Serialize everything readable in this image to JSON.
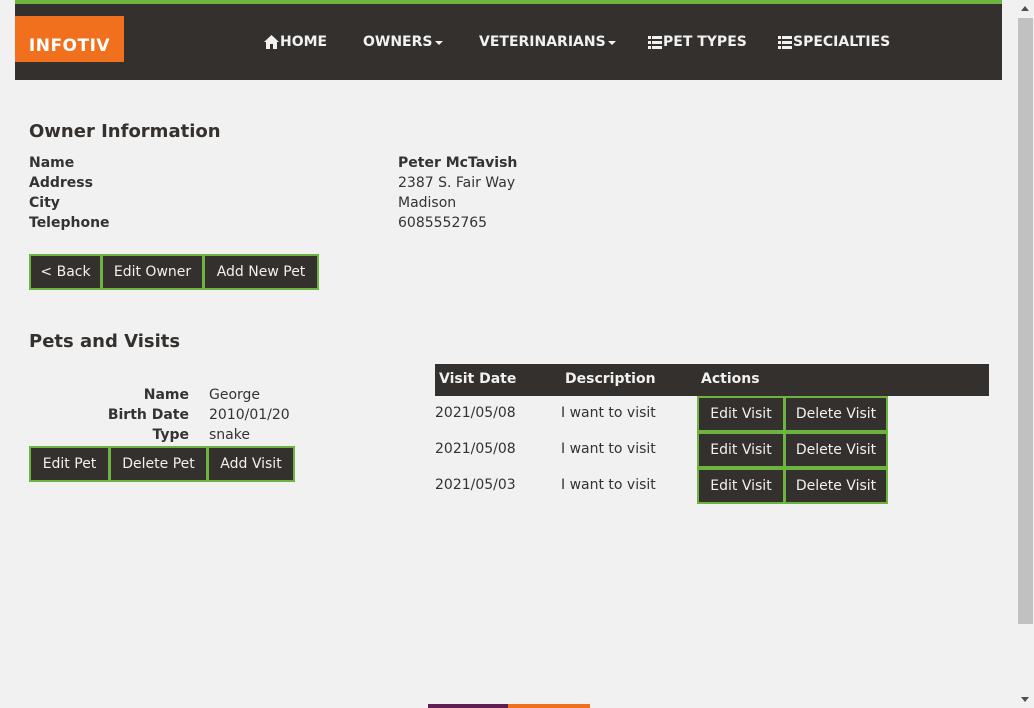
{
  "nav": {
    "brand": "INFOTIV",
    "home": "HOME",
    "owners": "OWNERS",
    "veterinarians": "VETERINARIANS",
    "pet_types": "PET TYPES",
    "specialties": "SPECIALTIES"
  },
  "owner": {
    "heading": "Owner Information",
    "fields": [
      {
        "label": "Name",
        "value": "Peter McTavish"
      },
      {
        "label": "Address",
        "value": "2387 S. Fair Way"
      },
      {
        "label": "City",
        "value": "Madison"
      },
      {
        "label": "Telephone",
        "value": "6085552765"
      }
    ],
    "buttons": {
      "back": "< Back",
      "edit": "Edit Owner",
      "add_pet": "Add New Pet"
    }
  },
  "pets": {
    "heading": "Pets and Visits",
    "pet": {
      "name_label": "Name",
      "name": "George",
      "birth_label": "Birth Date",
      "birth": "2010/01/20",
      "type_label": "Type",
      "type": "snake"
    },
    "buttons": {
      "edit_pet": "Edit Pet",
      "delete_pet": "Delete Pet",
      "add_visit": "Add Visit"
    },
    "visits": {
      "headers": [
        "Visit Date",
        "Description",
        "Actions"
      ],
      "rows": [
        {
          "date": "2021/05/08",
          "description": "I want to visit",
          "edit": "Edit Visit",
          "delete": "Delete Visit"
        },
        {
          "date": "2021/05/08",
          "description": "I want to visit",
          "edit": "Edit Visit",
          "delete": "Delete Visit"
        },
        {
          "date": "2021/05/03",
          "description": "I want to visit",
          "edit": "Edit Visit",
          "delete": "Delete Visit"
        }
      ]
    }
  },
  "colors": {
    "nav_bg": "#34302d",
    "accent_green": "#6db33f",
    "brand_orange": "#f1701e",
    "footer_purple": "#5f1e54"
  }
}
